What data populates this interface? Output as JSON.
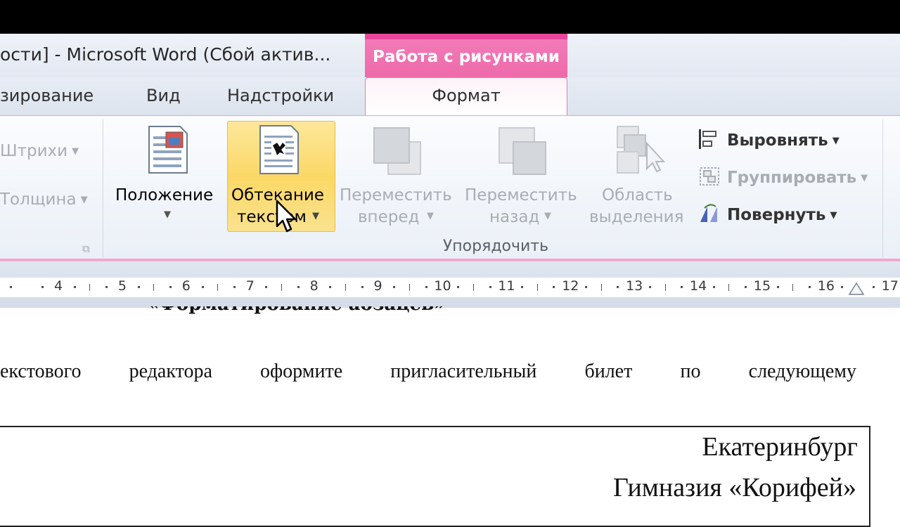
{
  "window": {
    "title": "ости]  -  Microsoft Word (Сбой актив..."
  },
  "tabs": {
    "review_partial": "зирование",
    "view": "Вид",
    "addins": "Надстройки"
  },
  "contextual": {
    "header": "Работа с рисунками",
    "format_tab": "Формат",
    "accent_color": "#ee6aab"
  },
  "ribbon": {
    "left_group": {
      "strokes": "Штрихи",
      "thickness": "Толщина"
    },
    "arrange": {
      "caption": "Упорядочить",
      "position": "Положение",
      "wrap_line1": "Обтекание",
      "wrap_line2": "текстом",
      "bring_forward_line1": "Переместить",
      "bring_forward_line2": "вперед",
      "send_backward_line1": "Переместить",
      "send_backward_line2": "назад",
      "selection_pane_line1": "Область",
      "selection_pane_line2": "выделения",
      "align": "Выровнять",
      "group": "Группировать",
      "rotate": "Повернуть"
    }
  },
  "ruler": {
    "numbers": [
      "4",
      "5",
      "6",
      "7",
      "8",
      "9",
      "10",
      "11",
      "12",
      "13",
      "14",
      "15",
      "16",
      "17"
    ]
  },
  "document": {
    "heading_partial": "«Форматирование абзацев»",
    "paragraph_words": [
      "екстового",
      "редактора",
      "оформите",
      "пригласительный",
      "билет",
      "по",
      "следующему"
    ],
    "city": "Екатеринбург",
    "school": "Гимназия «Корифей»"
  }
}
